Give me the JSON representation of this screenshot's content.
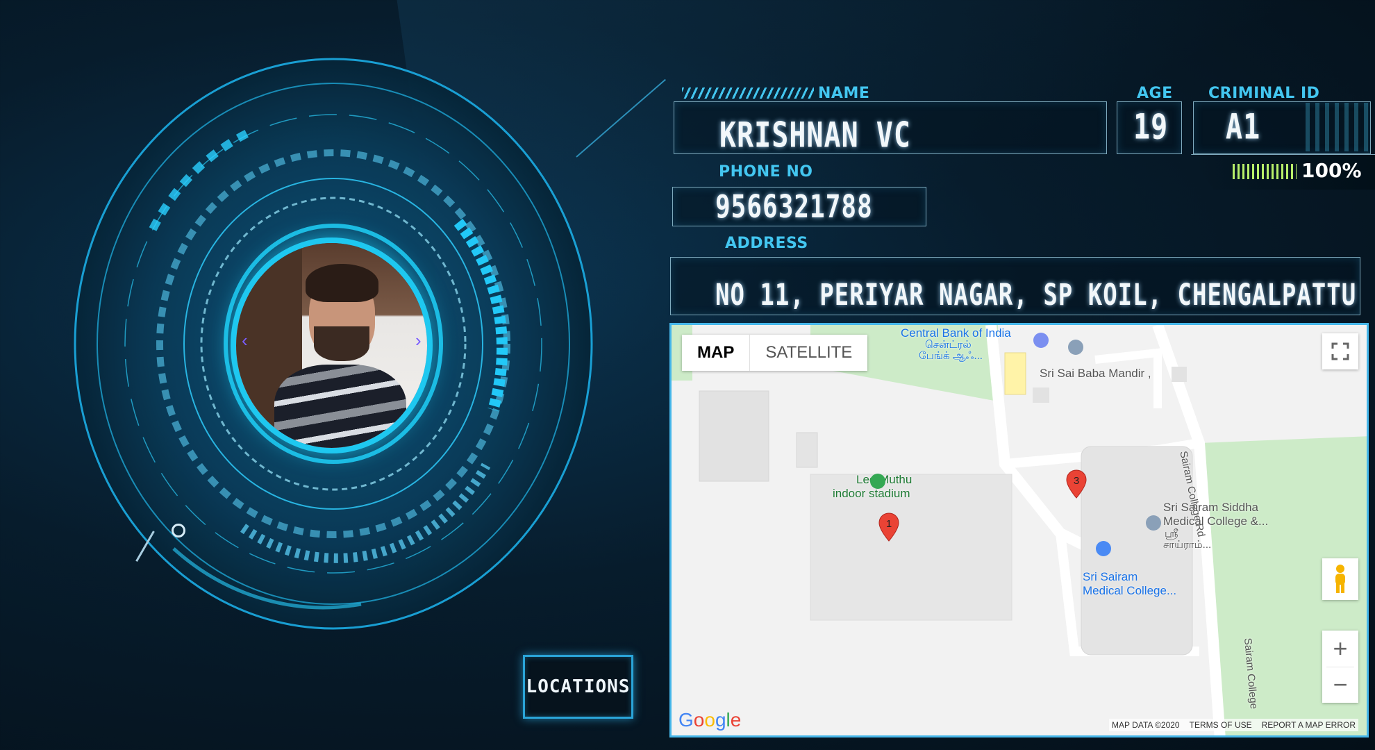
{
  "profile": {
    "name_label": "NAME",
    "name_value": "KRISHNAN VC",
    "age_label": "AGE",
    "age_value": "19",
    "criminal_id_label": "CRIMINAL ID",
    "criminal_id_value": "A1",
    "match_percent": "100%",
    "phone_label": "PHONE NO",
    "phone_value": "9566321788",
    "address_label": "ADDRESS",
    "address_value": "NO 11, PERIYAR NAGAR, SP KOIL, CHENGALPATTU"
  },
  "buttons": {
    "locations": "LOCATIONS"
  },
  "map": {
    "type_map": "MAP",
    "type_satellite": "SATELLITE",
    "labels": {
      "bank": "Central Bank of India",
      "bank_tamil": "சென்ட்ரல்",
      "bank_tamil2": "பேங்க் ஆஃ...",
      "temple": "Sri Sai Baba Mandir ,",
      "stadium1": "Leo Muthu",
      "stadium2": "indoor stadium",
      "road1": "Sairam College Rd",
      "road2": "Sairam College",
      "siddha1": "Sri Sairam Siddha",
      "siddha2": "Medical College &...",
      "siddha3": "ஸ்ரீ",
      "siddha4": "சாய்ராம்...",
      "medical1": "Sri Sairam",
      "medical2": "Medical College..."
    },
    "markers": [
      "1",
      "3"
    ],
    "zoom_in": "+",
    "zoom_out": "−",
    "attribution": [
      "MAP DATA ©2020",
      "TERMS OF USE",
      "REPORT A MAP ERROR"
    ],
    "logo": [
      "G",
      "o",
      "o",
      "g",
      "l",
      "e"
    ]
  },
  "colors": {
    "accent": "#43c6f0",
    "meter": "#b7f06a",
    "marker": "#ea4335"
  },
  "icons": [
    "fullscreen-icon",
    "pegman-icon",
    "chevron-left-icon",
    "chevron-right-icon"
  ]
}
